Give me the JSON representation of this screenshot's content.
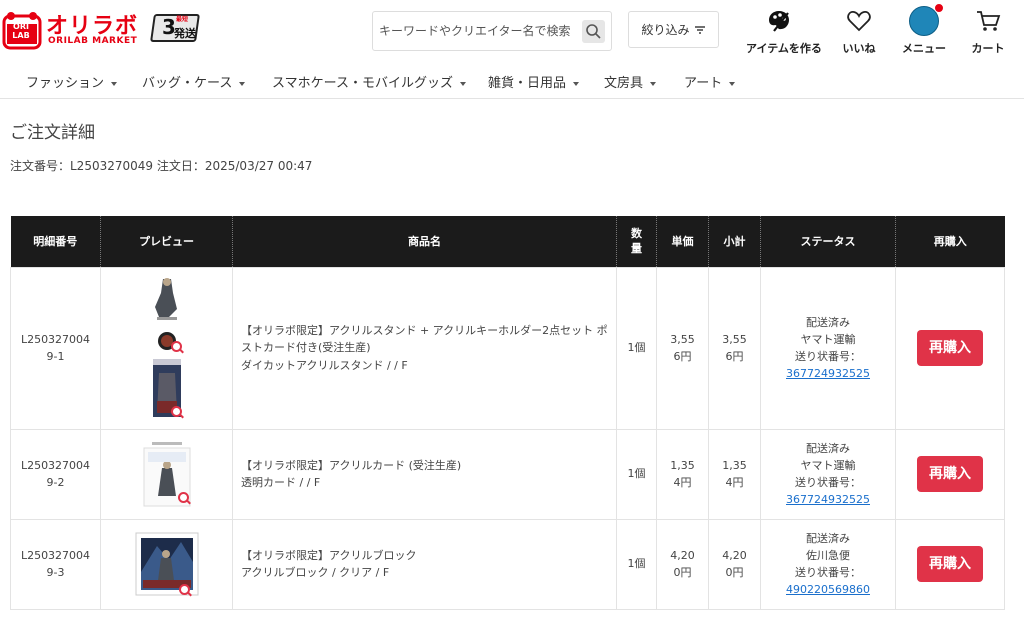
{
  "brand": {
    "logo_badge": "ORI LAB",
    "name": "オリラボ",
    "sub": "ORILAB MARKET",
    "ship_top": "最短",
    "ship_num": "3",
    "ship_text": "発送"
  },
  "search": {
    "placeholder": "キーワードやクリエイター名で検索"
  },
  "filter": {
    "label": "絞り込み"
  },
  "header_nav": [
    {
      "label": "アイテムを作る",
      "icon": "palette-icon"
    },
    {
      "label": "いいね",
      "icon": "heart-icon"
    },
    {
      "label": "メニュー",
      "icon": "avatar-icon"
    },
    {
      "label": "カート",
      "icon": "cart-icon"
    }
  ],
  "categories": [
    "ファッション",
    "バッグ・ケース",
    "スマホケース・モバイルグッズ",
    "雑貨・日用品",
    "文房具",
    "アート"
  ],
  "page": {
    "title": "ご注文詳細",
    "order_meta": "注文番号：L2503270049  注文日：2025/03/27 00:47"
  },
  "table": {
    "headers": {
      "detail_no": "明細番号",
      "preview": "プレビュー",
      "product": "商品名",
      "qty": "数量",
      "unit_price": "単価",
      "subtotal": "小計",
      "status": "ステータス",
      "rebuy": "再購入"
    },
    "rows": [
      {
        "detail_no": "L2503270049-1",
        "name_line1": "【オリラボ限定】アクリルスタンド + アクリルキーホルダー2点セット ポストカード付き(受注生産)",
        "name_line2": "ダイカットアクリルスタンド / / F",
        "qty": "1個",
        "unit_price": "3,556円",
        "subtotal": "3,556円",
        "status": "配送済み",
        "carrier": "ヤマト運輸",
        "tracking_label": "送り状番号：",
        "tracking_no": "367724932525",
        "rebuy": "再購入"
      },
      {
        "detail_no": "L2503270049-2",
        "name_line1": "【オリラボ限定】アクリルカード (受注生産)",
        "name_line2": "透明カード / / F",
        "qty": "1個",
        "unit_price": "1,354円",
        "subtotal": "1,354円",
        "status": "配送済み",
        "carrier": "ヤマト運輸",
        "tracking_label": "送り状番号：",
        "tracking_no": "367724932525",
        "rebuy": "再購入"
      },
      {
        "detail_no": "L2503270049-3",
        "name_line1": "【オリラボ限定】アクリルブロック",
        "name_line2": "アクリルブロック / クリア / F",
        "qty": "1個",
        "unit_price": "4,200円",
        "subtotal": "4,200円",
        "status": "配送済み",
        "carrier": "佐川急便",
        "tracking_label": "送り状番号：",
        "tracking_no": "490220569860",
        "rebuy": "再購入"
      }
    ]
  },
  "colors": {
    "brand_red": "#e60012",
    "rebuy_red": "#e03348",
    "link_blue": "#1a6fcc",
    "table_header": "#1b1b1b"
  }
}
